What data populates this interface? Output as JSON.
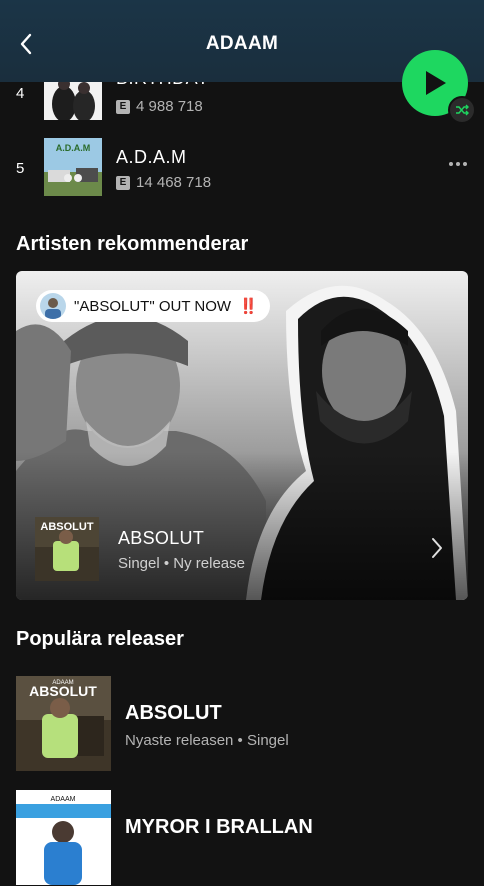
{
  "header": {
    "title": "ADAAM"
  },
  "tracks": [
    {
      "number": "4",
      "title": "BIRTHDAY",
      "explicit": "E",
      "plays": "4 988 718"
    },
    {
      "number": "5",
      "title": "A.D.A.M",
      "explicit": "E",
      "plays": "14 468 718"
    }
  ],
  "recommend": {
    "section_title": "Artisten rekommenderar",
    "tag_text": "\"ABSOLUT\" OUT NOW",
    "tag_emoji": "‼️",
    "release_title": "ABSOLUT",
    "release_art_text": "ABSOLUT",
    "release_sub": "Singel • Ny release"
  },
  "popular": {
    "section_title": "Populära releaser",
    "items": [
      {
        "title": "ABSOLUT",
        "art_artist": "ADAAM",
        "art_text": "ABSOLUT",
        "sub": "Nyaste releasen • Singel"
      },
      {
        "title": "MYROR I BRALLAN",
        "art_artist": "ADAAM",
        "sub": ""
      }
    ]
  },
  "colors": {
    "background": "#121212",
    "header": "#1b3547",
    "accent_green": "#1ed760",
    "secondary_text": "#b3b3b3"
  }
}
